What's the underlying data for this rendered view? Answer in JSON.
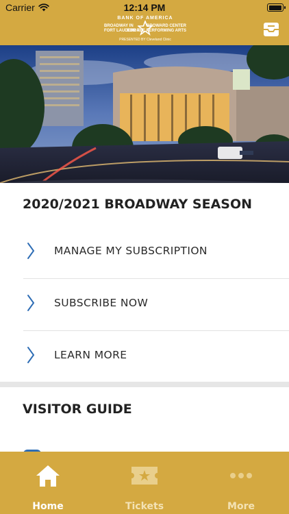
{
  "status_bar": {
    "carrier": "Carrier",
    "time": "12:14 PM"
  },
  "header": {
    "logo_line1": "BANK OF AMERICA",
    "logo_left_line1": "BROADWAY IN",
    "logo_left_line2": "FORT LAUDERDALE",
    "logo_right_line1": "BROWARD CENTER",
    "logo_right_line2": "FOR THE PERFORMING ARTS",
    "logo_line3": "PRESENTED BY Cleveland Clinic",
    "inbox_icon": "inbox-icon"
  },
  "season": {
    "title": "2020/2021 BROADWAY SEASON",
    "items": [
      {
        "label": "MANAGE MY SUBSCRIPTION"
      },
      {
        "label": "SUBSCRIBE NOW"
      },
      {
        "label": "LEARN MORE"
      }
    ]
  },
  "visitor_guide": {
    "title": "VISITOR GUIDE"
  },
  "tab_bar": {
    "tabs": [
      {
        "label": "Home",
        "icon": "home-icon",
        "active": true
      },
      {
        "label": "Tickets",
        "icon": "ticket-icon",
        "active": false
      },
      {
        "label": "More",
        "icon": "more-dots-icon",
        "active": false
      }
    ]
  },
  "colors": {
    "brand_gold": "#d4a941",
    "chevron_blue": "#2e6db5",
    "text_dark": "#222222"
  }
}
